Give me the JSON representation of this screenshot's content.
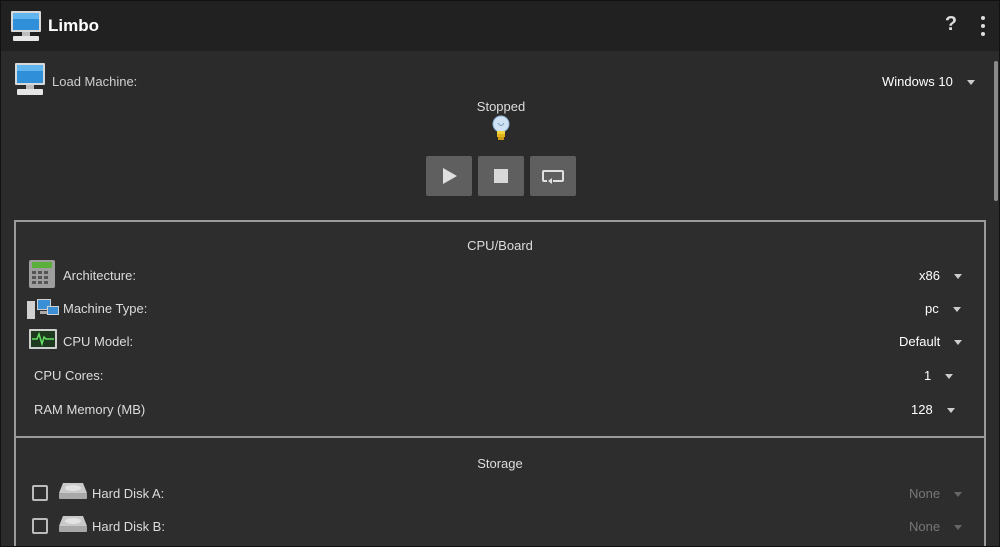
{
  "app": {
    "title": "Limbo",
    "help_label": "?"
  },
  "machine": {
    "label": "Load Machine:",
    "selected": "Windows 10",
    "status": "Stopped"
  },
  "controls": {
    "start_icon": "play-icon",
    "stop_icon": "stop-icon",
    "restart_icon": "restart-icon"
  },
  "cpu_board": {
    "title": "CPU/Board",
    "rows": [
      {
        "label": "Architecture:",
        "value": "x86",
        "icon": "calculator-icon"
      },
      {
        "label": "Machine Type:",
        "value": "pc",
        "icon": "computers-icon"
      },
      {
        "label": "CPU Model:",
        "value": "Default",
        "icon": "cpu-monitor-icon"
      },
      {
        "label": "CPU Cores:",
        "value": "1"
      },
      {
        "label": "RAM Memory (MB)",
        "value": "128"
      }
    ]
  },
  "storage": {
    "title": "Storage",
    "rows": [
      {
        "label": "Hard Disk A:",
        "value": "None",
        "checked": false,
        "icon": "hard-disk-icon"
      },
      {
        "label": "Hard Disk B:",
        "value": "None",
        "checked": false,
        "icon": "hard-disk-icon"
      }
    ]
  },
  "colors": {
    "appbar": "#212121",
    "background": "#2b2b2b",
    "control_button": "#5f5f5f",
    "panel_border": "#9a9a9a"
  }
}
